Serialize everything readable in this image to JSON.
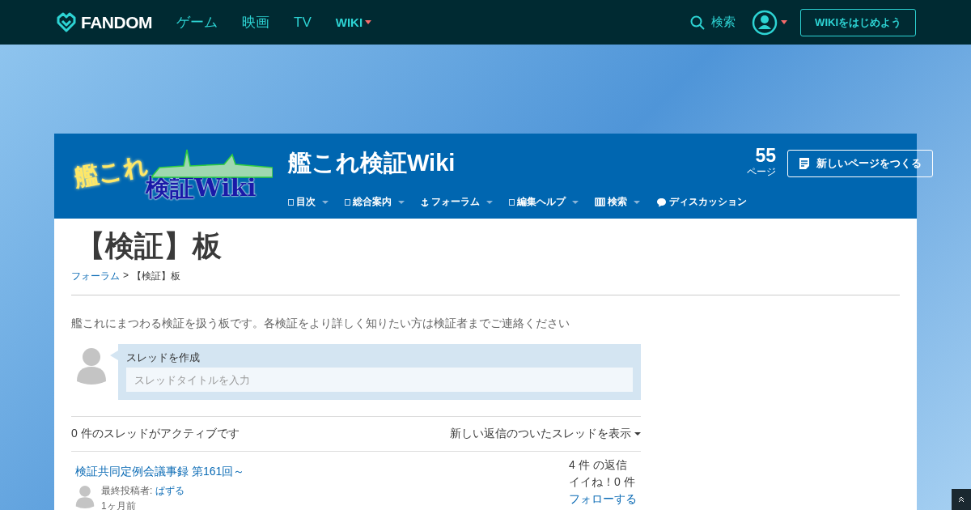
{
  "top_bar": {
    "brand": "FANDOM",
    "nav": [
      {
        "label": "ゲーム",
        "kind": "link"
      },
      {
        "label": "映画",
        "kind": "link"
      },
      {
        "label": "TV",
        "kind": "link"
      },
      {
        "label": "WIKI",
        "kind": "menu"
      }
    ],
    "search": "検索",
    "start_button": "WIKIをはじめよう"
  },
  "wiki_header": {
    "logo_lines": [
      "艦これ",
      "検証Wiki"
    ],
    "title": "艦これ検証Wiki",
    "page_count": "55",
    "page_count_label": "ページ",
    "new_page_button": "新しいページをつくる",
    "nav": [
      {
        "label": "目次",
        "kind": "square",
        "dropdown": true
      },
      {
        "label": "総合案内",
        "kind": "square",
        "dropdown": true
      },
      {
        "label": "フォーラム",
        "kind": "anchor",
        "dropdown": true
      },
      {
        "label": "編集ヘルプ",
        "kind": "square",
        "dropdown": true
      },
      {
        "label": "検索",
        "kind": "book",
        "dropdown": true
      },
      {
        "label": "ディスカッション",
        "kind": "bubble",
        "dropdown": false
      }
    ]
  },
  "page": {
    "title": "【検証】板",
    "breadcrumb": {
      "link": "フォーラム",
      "separator": ">",
      "current": "【検証】板"
    },
    "description": "艦これにまつわる検証を扱う板です。各検証をより詳しく知りたい方は検証者までご連絡ください",
    "new_thread": {
      "label": "スレッドを作成",
      "placeholder": "スレッドタイトルを入力"
    },
    "thread_count": "0 件のスレッドがアクティブです",
    "sort": "新しい返信のついたスレッドを表示",
    "threads": [
      {
        "title": "検証共同定例会議事録 第161回～",
        "last_poster_label": "最終投稿者:",
        "last_poster": "ぱずる",
        "time": "1ヶ月前",
        "replies": "4 件 の返信",
        "likes": "イイね！0 件",
        "follow": "フォローする"
      }
    ]
  }
}
